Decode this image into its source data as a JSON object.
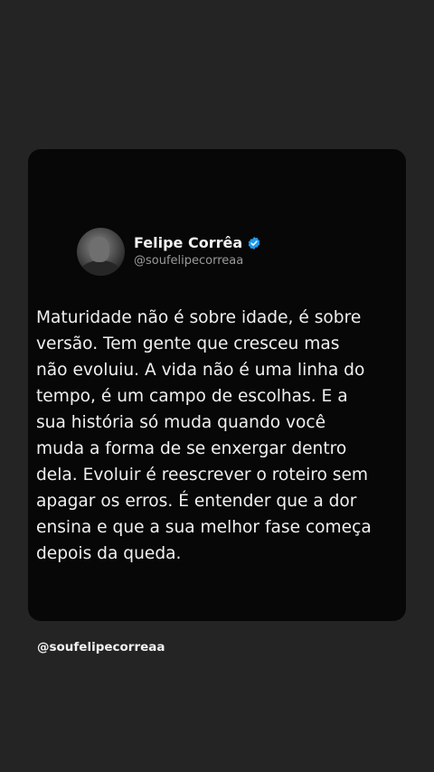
{
  "post": {
    "display_name": "Felipe Corrêa",
    "handle": "@soufelipecorreaa",
    "verified_icon": "verified-badge-icon",
    "text": "Maturidade não é sobre idade, é sobre\nversão. Tem gente que cresceu mas\nnão evoluiu. A vida não é uma linha do\ntempo, é um campo de escolhas. E a\nsua história só muda quando você\nmuda a forma de se enxergar dentro\ndela. Evoluir é reescrever o roteiro sem\napagar os erros. É entender que a dor\nensina e que a sua melhor fase começa\ndepois da queda."
  },
  "footer": {
    "handle": "@soufelipecorreaa"
  },
  "colors": {
    "background": "#242424",
    "card": "#070707",
    "verified": "#1d9bf0",
    "text": "#f0f0f0",
    "handle": "#9a9a9a"
  }
}
